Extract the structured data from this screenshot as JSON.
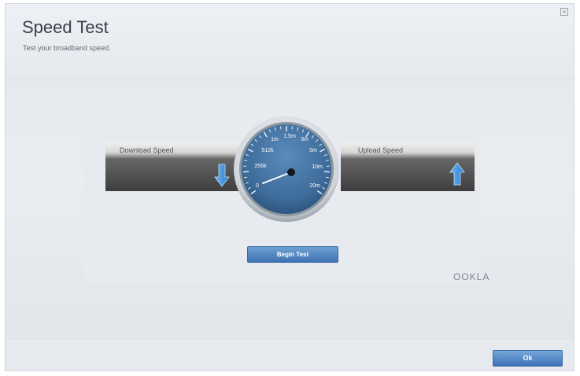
{
  "dialog": {
    "title": "Speed Test",
    "subtitle": "Test your broadband speed.",
    "close_icon": "close-icon"
  },
  "panels": {
    "download_label": "Download Speed",
    "upload_label": "Upload Speed",
    "download_icon": "arrow-down-icon",
    "upload_icon": "arrow-up-icon"
  },
  "gauge": {
    "scale_labels": [
      "0",
      "256k",
      "512k",
      "1m",
      "1.5m",
      "3m",
      "5m",
      "10m",
      "20m"
    ],
    "current_value": "0"
  },
  "actions": {
    "begin_test_label": "Begin Test",
    "ok_label": "Ok"
  },
  "branding": {
    "ookla_text": "OOKLA"
  },
  "colors": {
    "accent_blue": "#3f72b3",
    "gauge_face": "#3d6b9a",
    "panel_dark": "#3e3e3e"
  }
}
